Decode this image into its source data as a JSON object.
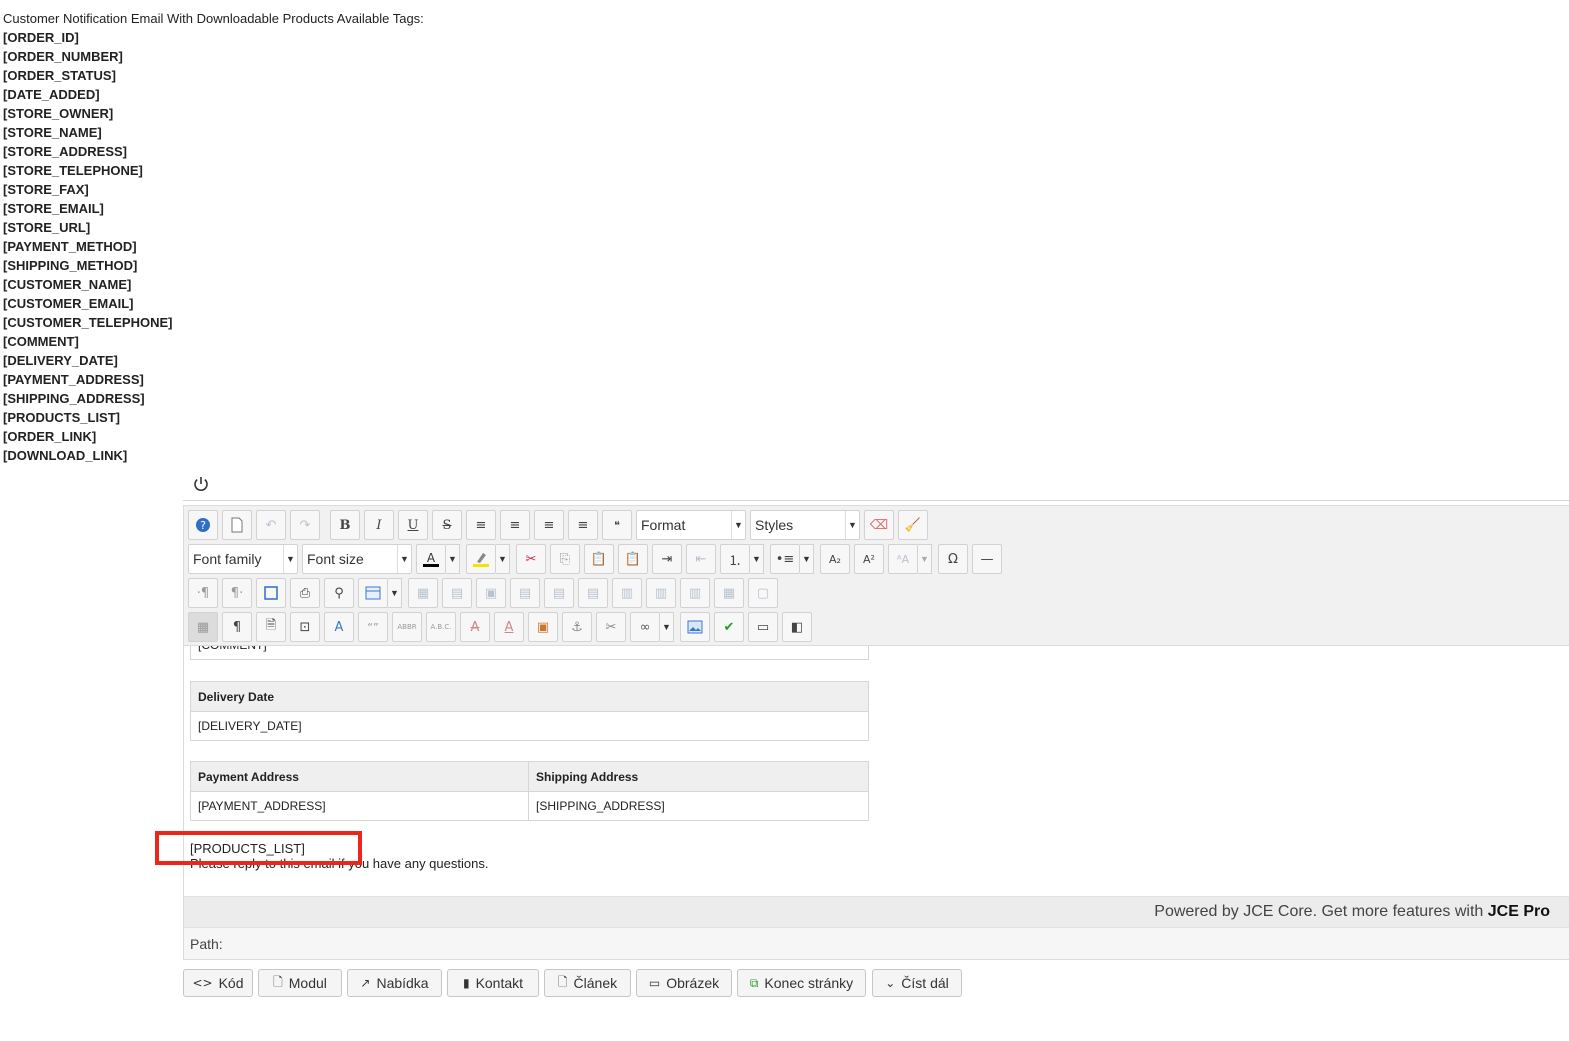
{
  "heading": "Customer Notification Email With Downloadable Products Available Tags:",
  "tags": [
    "[ORDER_ID]",
    "[ORDER_NUMBER]",
    "[ORDER_STATUS]",
    "[DATE_ADDED]",
    "[STORE_OWNER]",
    "[STORE_NAME]",
    "[STORE_ADDRESS]",
    "[STORE_TELEPHONE]",
    "[STORE_FAX]",
    "[STORE_EMAIL]",
    "[STORE_URL]",
    "[PAYMENT_METHOD]",
    "[SHIPPING_METHOD]",
    "[CUSTOMER_NAME]",
    "[CUSTOMER_EMAIL]",
    "[CUSTOMER_TELEPHONE]",
    "[COMMENT]",
    "[DELIVERY_DATE]",
    "[PAYMENT_ADDRESS]",
    "[SHIPPING_ADDRESS]",
    "[PRODUCTS_LIST]",
    "[ORDER_LINK]",
    "[DOWNLOAD_LINK]"
  ],
  "toolbar": {
    "format_label": "Format",
    "styles_label": "Styles",
    "font_family_label": "Font family",
    "font_size_label": "Font size"
  },
  "content": {
    "comment_value": "[COMMENT]",
    "delivery_header": "Delivery Date",
    "delivery_value": "[DELIVERY_DATE]",
    "payment_header": "Payment Address",
    "shipping_header": "Shipping Address",
    "payment_value": "[PAYMENT_ADDRESS]",
    "shipping_value": "[SHIPPING_ADDRESS]",
    "products_list": "[PRODUCTS_LIST]",
    "reply_text": "Please reply to this email if you have any questions."
  },
  "footer": {
    "powered_prefix": "Powered by JCE Core. Get more features with ",
    "powered_brand": "JCE Pro",
    "path_label": "Path:"
  },
  "buttons": [
    "Kód",
    "Modul",
    "Nabídka",
    "Kontakt",
    "Článek",
    "Obrázek",
    "Konec stránky",
    "Číst dál"
  ],
  "colors": {
    "highlight": "#e8281a",
    "toolbar_bg": "#f1f1f1"
  }
}
